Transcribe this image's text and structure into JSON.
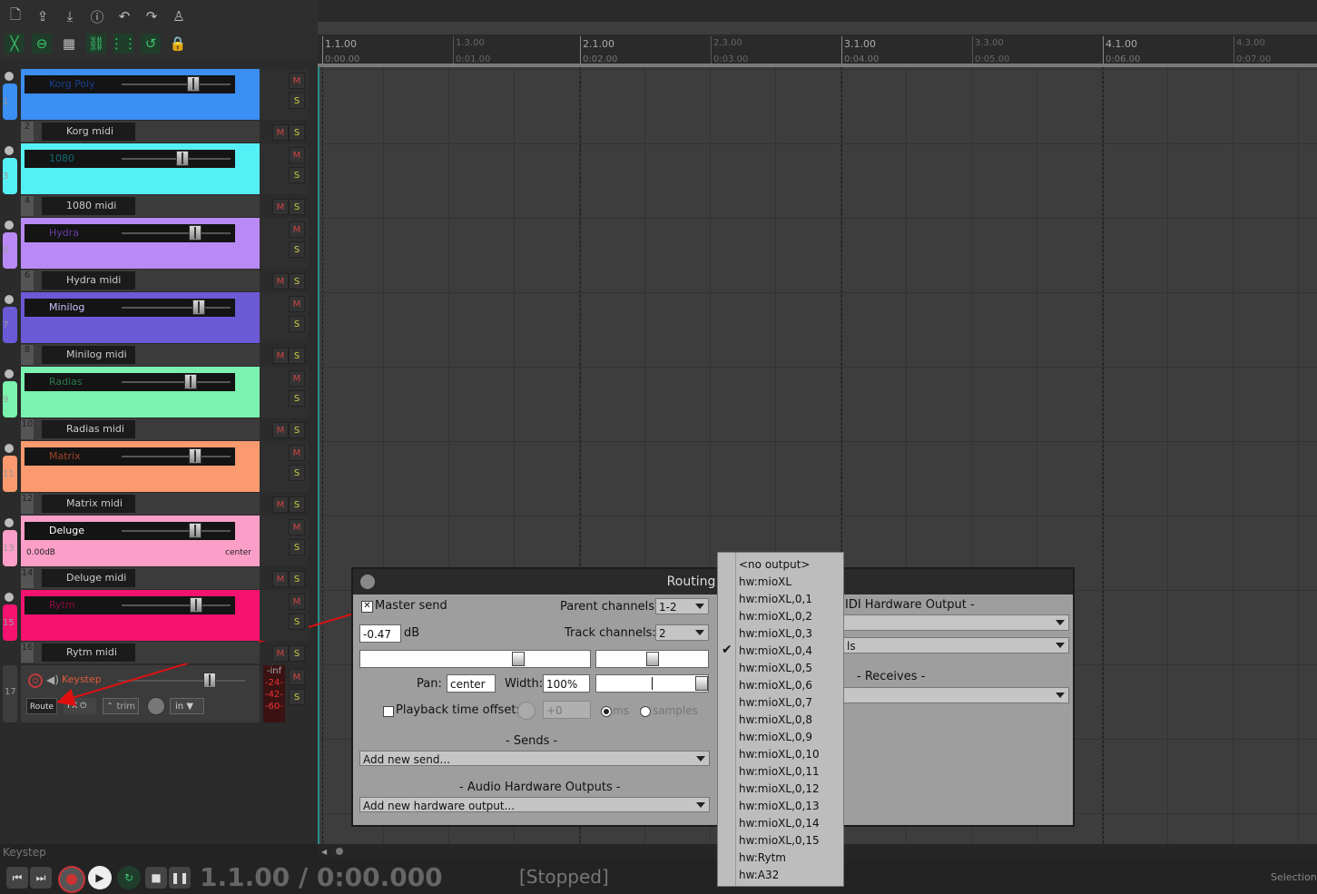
{
  "tracks": [
    {
      "num": "1",
      "name": "Korg Poly",
      "color": "#3b8ef2",
      "text": "#1a3f8f",
      "child_num": "2",
      "child_name": "Korg midi"
    },
    {
      "num": "3",
      "name": "1080",
      "color": "#55f0f5",
      "text": "#106a70",
      "child_num": "4",
      "child_name": "1080 midi"
    },
    {
      "num": "5",
      "name": "Hydra",
      "color": "#b98af5",
      "text": "#6a3aa0",
      "child_num": "6",
      "child_name": "Hydra midi"
    },
    {
      "num": "7",
      "name": "Minilog",
      "color": "#6a5ad6",
      "text": "#c8c0ff",
      "child_num": "8",
      "child_name": "Minilog midi"
    },
    {
      "num": "9",
      "name": "Radias",
      "color": "#7af2b0",
      "text": "#2a7a50",
      "child_num": "10",
      "child_name": "Radias midi"
    },
    {
      "num": "11",
      "name": "Matrix",
      "color": "#fa9a6e",
      "text": "#a0452a",
      "child_num": "12",
      "child_name": "Matrix midi"
    },
    {
      "num": "13",
      "name": "Deluge",
      "color": "#fb9fc8",
      "text": "#ffffff",
      "child_num": "14",
      "child_name": "Deluge midi",
      "vol": "0.00dB",
      "pan": "center"
    },
    {
      "num": "15",
      "name": "Rytm",
      "color": "#f5136f",
      "text": "#8a0a3d",
      "child_num": "16",
      "child_name": "Rytm midi"
    }
  ],
  "keystep": {
    "num": "17",
    "name": "Keystep",
    "route": "Route",
    "fx": "FX",
    "trim": "trim",
    "in": "in",
    "meter": [
      "-inf",
      "-24-",
      "-42-",
      "-60-"
    ]
  },
  "mute_label": "M",
  "solo_label": "S",
  "ruler": {
    "major": [
      {
        "bar": "1.1.00",
        "time": "0:00.00"
      },
      {
        "bar": "2.1.00",
        "time": "0:02.00"
      },
      {
        "bar": "3.1.00",
        "time": "0:04.00"
      },
      {
        "bar": "4.1.00",
        "time": "0:06.00"
      }
    ],
    "minor": [
      {
        "bar": "1.3.00",
        "time": "0:01.00"
      },
      {
        "bar": "2.3.00",
        "time": "0:03.00"
      },
      {
        "bar": "3.3.00",
        "time": "0:05.00"
      },
      {
        "bar": "4.3.00",
        "time": "0:07.00"
      }
    ]
  },
  "status": {
    "track_label": "Keystep",
    "position": "1.1.00 / 0:00.000",
    "state": "[Stopped]",
    "selection": "Selection:"
  },
  "dialog": {
    "title": "Routing for tra",
    "master_send": "Master send",
    "master_checked": "✕",
    "parent_channels_label": "Parent channels:",
    "parent_channels": "1-2",
    "track_channels_label": "Track channels:",
    "track_channels": "2",
    "volume": "-0.47",
    "db": "dB",
    "pan_label": "Pan:",
    "pan": "center",
    "width_label": "Width:",
    "width": "100%",
    "playback_offset": "Playback time offset:",
    "offset_value": "+0",
    "ms": "ms",
    "samples": "samples",
    "sends_header": "-  Sends  -",
    "add_send": "Add new send...",
    "hw_header": "-  Audio Hardware Outputs  -",
    "add_hw": "Add new hardware output...",
    "midi_hw_header": "IDI Hardware Output  -",
    "midi_combo2": "ls",
    "receives_header": "-  Receives  -"
  },
  "dropdown": {
    "items": [
      "<no output>",
      "hw:mioXL",
      "hw:mioXL,0,1",
      "hw:mioXL,0,2",
      "hw:mioXL,0,3",
      "hw:mioXL,0,4",
      "hw:mioXL,0,5",
      "hw:mioXL,0,6",
      "hw:mioXL,0,7",
      "hw:mioXL,0,8",
      "hw:mioXL,0,9",
      "hw:mioXL,0,10",
      "hw:mioXL,0,11",
      "hw:mioXL,0,12",
      "hw:mioXL,0,13",
      "hw:mioXL,0,14",
      "hw:mioXL,0,15",
      "hw:Rytm",
      "hw:A32"
    ],
    "checked_index": 5
  }
}
